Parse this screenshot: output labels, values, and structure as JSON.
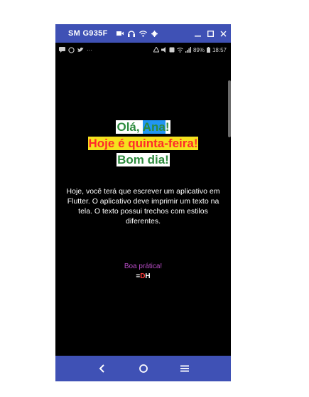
{
  "window": {
    "title": "SM G935F",
    "title_icons": [
      "video-camera-icon",
      "headphones-icon",
      "wifi-icon",
      "gear-icon"
    ],
    "controls": [
      "minimize-icon",
      "maximize-icon",
      "close-icon"
    ]
  },
  "statusbar": {
    "left_icons": [
      "message-icon",
      "whatsapp-icon",
      "twitter-icon"
    ],
    "more": "···",
    "battery": "89%",
    "time": "18:57"
  },
  "greeting": {
    "line1_prefix": "Olá, ",
    "name": "Ana",
    "line1_suffix": "!",
    "line2": "Hoje é quinta-feira!",
    "line3": "Bom dia!"
  },
  "description": "Hoje, você terá que escrever um aplicativo em Flutter. O aplicativo deve imprimir um texto na tela. O texto possui trechos com estilos diferentes.",
  "footer": {
    "line1": "Boa prática!",
    "eq": "=",
    "d": "D",
    "h": "H"
  },
  "colors": {
    "titlebar": "#3f51b5",
    "green_text": "#2e8b3e",
    "name_bg": "#2196f3",
    "line2_bg": "#f5e11e",
    "line2_text": "#ff2a2a",
    "footer1": "#b84cc6",
    "d_letter": "#ff3b3b"
  },
  "navbar": [
    "back-icon",
    "home-icon",
    "recents-icon"
  ]
}
